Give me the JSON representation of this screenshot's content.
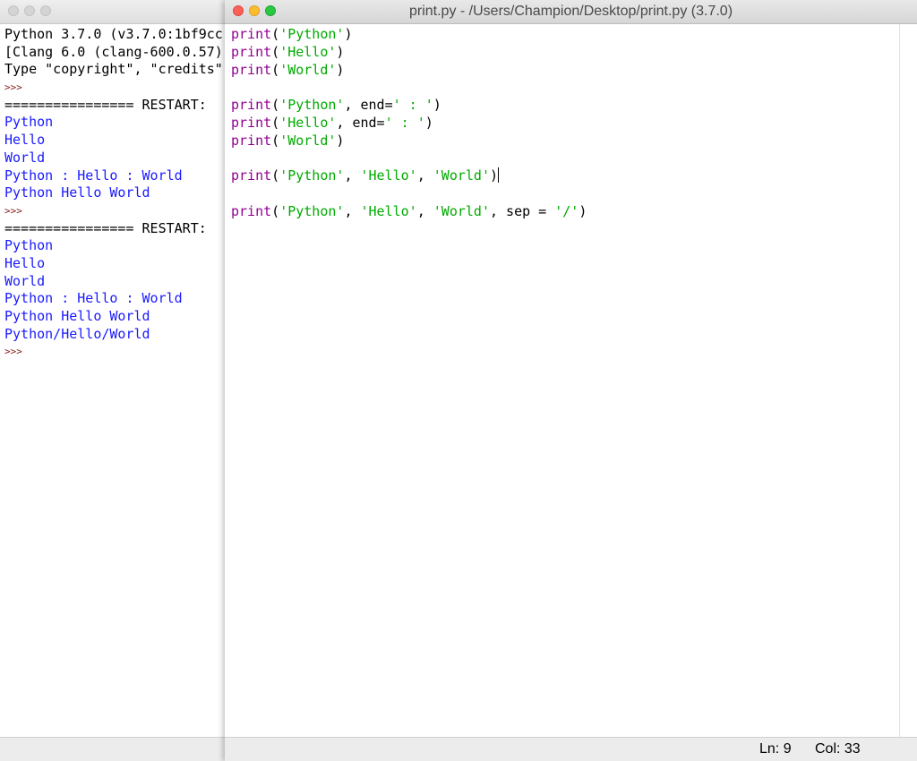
{
  "shell": {
    "lines": [
      {
        "text": "Python 3.7.0 (v3.7.0:1bf9cc",
        "kind": "black"
      },
      {
        "text": "[Clang 6.0 (clang-600.0.57)",
        "kind": "black"
      },
      {
        "text": "Type \"copyright\", \"credits\"",
        "kind": "black"
      },
      {
        "text": ">>>",
        "kind": "prompt"
      },
      {
        "text": "================ RESTART:",
        "kind": "black"
      },
      {
        "text": "Python",
        "kind": "blue"
      },
      {
        "text": "Hello",
        "kind": "blue"
      },
      {
        "text": "World",
        "kind": "blue"
      },
      {
        "text": "Python : Hello : World",
        "kind": "blue"
      },
      {
        "text": "Python Hello World",
        "kind": "blue"
      },
      {
        "text": ">>>",
        "kind": "prompt"
      },
      {
        "text": "================ RESTART:",
        "kind": "black"
      },
      {
        "text": "Python",
        "kind": "blue"
      },
      {
        "text": "Hello",
        "kind": "blue"
      },
      {
        "text": "World",
        "kind": "blue"
      },
      {
        "text": "Python : Hello : World",
        "kind": "blue"
      },
      {
        "text": "Python Hello World",
        "kind": "blue"
      },
      {
        "text": "Python/Hello/World",
        "kind": "blue"
      },
      {
        "text": ">>>",
        "kind": "prompt"
      }
    ]
  },
  "editor": {
    "title": "print.py - /Users/Champion/Desktop/print.py (3.7.0)",
    "lines": [
      [
        {
          "t": "print",
          "k": "builtin"
        },
        {
          "t": "(",
          "k": "plain"
        },
        {
          "t": "'Python'",
          "k": "string"
        },
        {
          "t": ")",
          "k": "plain"
        }
      ],
      [
        {
          "t": "print",
          "k": "builtin"
        },
        {
          "t": "(",
          "k": "plain"
        },
        {
          "t": "'Hello'",
          "k": "string"
        },
        {
          "t": ")",
          "k": "plain"
        }
      ],
      [
        {
          "t": "print",
          "k": "builtin"
        },
        {
          "t": "(",
          "k": "plain"
        },
        {
          "t": "'World'",
          "k": "string"
        },
        {
          "t": ")",
          "k": "plain"
        }
      ],
      [],
      [
        {
          "t": "print",
          "k": "builtin"
        },
        {
          "t": "(",
          "k": "plain"
        },
        {
          "t": "'Python'",
          "k": "string"
        },
        {
          "t": ", end=",
          "k": "plain"
        },
        {
          "t": "' : '",
          "k": "string"
        },
        {
          "t": ")",
          "k": "plain"
        }
      ],
      [
        {
          "t": "print",
          "k": "builtin"
        },
        {
          "t": "(",
          "k": "plain"
        },
        {
          "t": "'Hello'",
          "k": "string"
        },
        {
          "t": ", end=",
          "k": "plain"
        },
        {
          "t": "' : '",
          "k": "string"
        },
        {
          "t": ")",
          "k": "plain"
        }
      ],
      [
        {
          "t": "print",
          "k": "builtin"
        },
        {
          "t": "(",
          "k": "plain"
        },
        {
          "t": "'World'",
          "k": "string"
        },
        {
          "t": ")",
          "k": "plain"
        }
      ],
      [],
      [
        {
          "t": "print",
          "k": "builtin"
        },
        {
          "t": "(",
          "k": "plain"
        },
        {
          "t": "'Python'",
          "k": "string"
        },
        {
          "t": ", ",
          "k": "plain"
        },
        {
          "t": "'Hello'",
          "k": "string"
        },
        {
          "t": ", ",
          "k": "plain"
        },
        {
          "t": "'World'",
          "k": "string"
        },
        {
          "t": ")",
          "k": "plain"
        },
        {
          "t": "",
          "k": "cursor"
        }
      ],
      [],
      [
        {
          "t": "print",
          "k": "builtin"
        },
        {
          "t": "(",
          "k": "plain"
        },
        {
          "t": "'Python'",
          "k": "string"
        },
        {
          "t": ", ",
          "k": "plain"
        },
        {
          "t": "'Hello'",
          "k": "string"
        },
        {
          "t": ", ",
          "k": "plain"
        },
        {
          "t": "'World'",
          "k": "string"
        },
        {
          "t": ", sep = ",
          "k": "plain"
        },
        {
          "t": "'/'",
          "k": "string"
        },
        {
          "t": ")",
          "k": "plain"
        }
      ]
    ],
    "status": {
      "ln": "Ln: 9",
      "col": "Col: 33"
    }
  },
  "colors": {
    "builtin": "#900090",
    "string": "#00aa00",
    "shell_output": "#1a1aff",
    "prompt": "#8b1a1a"
  }
}
